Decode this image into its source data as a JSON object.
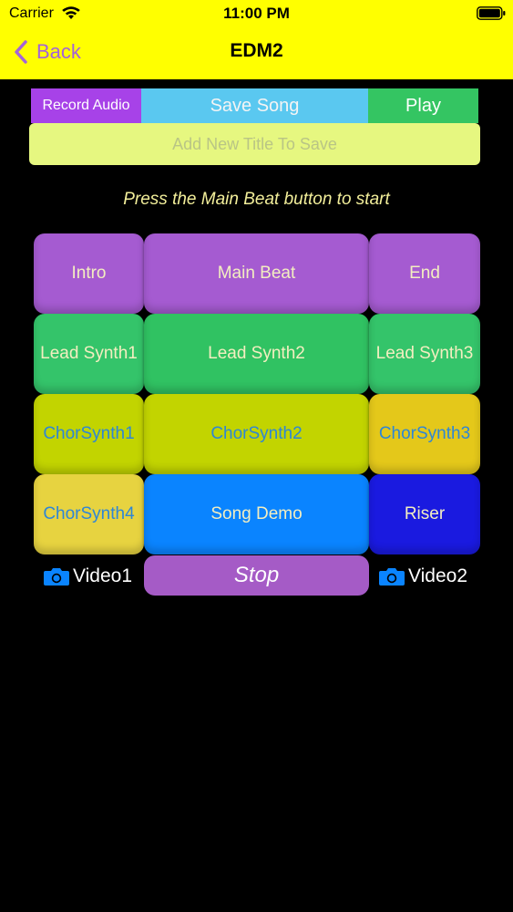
{
  "status_bar": {
    "carrier": "Carrier",
    "time": "11:00 PM"
  },
  "nav": {
    "back_label": "Back",
    "title": "EDM2"
  },
  "toolbar": {
    "record_label": "Record Audio",
    "save_label": "Save Song",
    "play_label": "Play"
  },
  "title_input": {
    "value": "",
    "placeholder": "Add New Title To Save"
  },
  "hint": "Press the Main Beat button to start",
  "pads": {
    "intro": "Intro",
    "main_beat": "Main Beat",
    "end": "End",
    "lead_synth1": "Lead Synth1",
    "lead_synth2": "Lead Synth2",
    "lead_synth3": "Lead Synth3",
    "chor_synth1": "ChorSynth1",
    "chor_synth2": "ChorSynth2",
    "chor_synth3": "ChorSynth3",
    "chor_synth4": "ChorSynth4",
    "song_demo": "Song Demo",
    "riser": "Riser"
  },
  "stop_label": "Stop",
  "video1_label": "Video1",
  "video2_label": "Video2",
  "colors": {
    "header": "#ffff00",
    "accent_purple": "#a463d8",
    "pad_purple": "#a55bd1",
    "pad_green": "#34c46a",
    "pad_lime": "#c2d400",
    "pad_yellow": "#e7d340",
    "pad_blue": "#0a84ff",
    "pad_indigo": "#1a1ae0",
    "stop": "#a55bc6"
  }
}
